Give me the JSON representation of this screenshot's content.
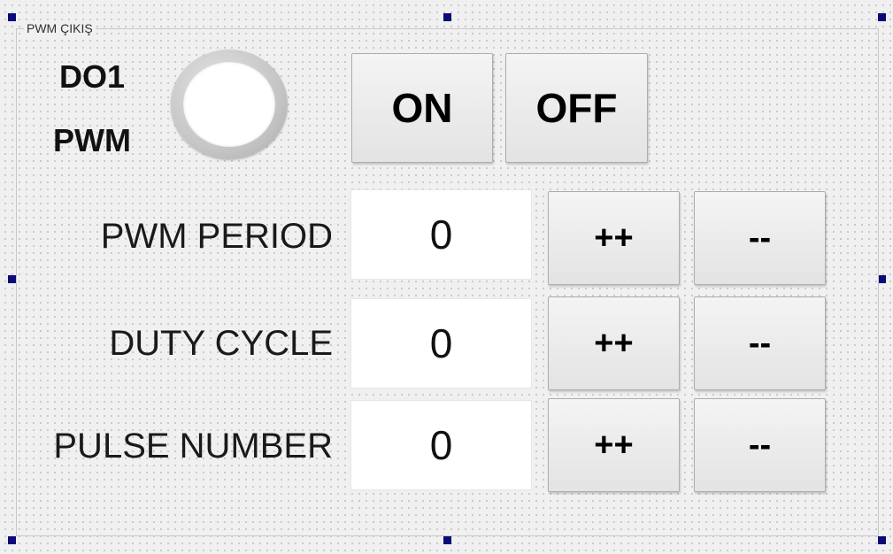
{
  "group": {
    "title": "PWM ÇIKIŞ"
  },
  "output": {
    "label_line1": "DO1",
    "label_line2": "PWM",
    "led_icon": "status-led-icon",
    "led_state": "off"
  },
  "buttons": {
    "on_label": "ON",
    "off_label": "OFF"
  },
  "rows": [
    {
      "label": "PWM PERIOD",
      "value": "0",
      "increment_label": "++",
      "decrement_label": "--"
    },
    {
      "label": "DUTY CYCLE",
      "value": "0",
      "increment_label": "++",
      "decrement_label": "--"
    },
    {
      "label": "PULSE NUMBER",
      "value": "0",
      "increment_label": "++",
      "decrement_label": "--"
    }
  ],
  "colors": {
    "selection_handle": "#0a0a78",
    "background": "#f0f0f0"
  }
}
